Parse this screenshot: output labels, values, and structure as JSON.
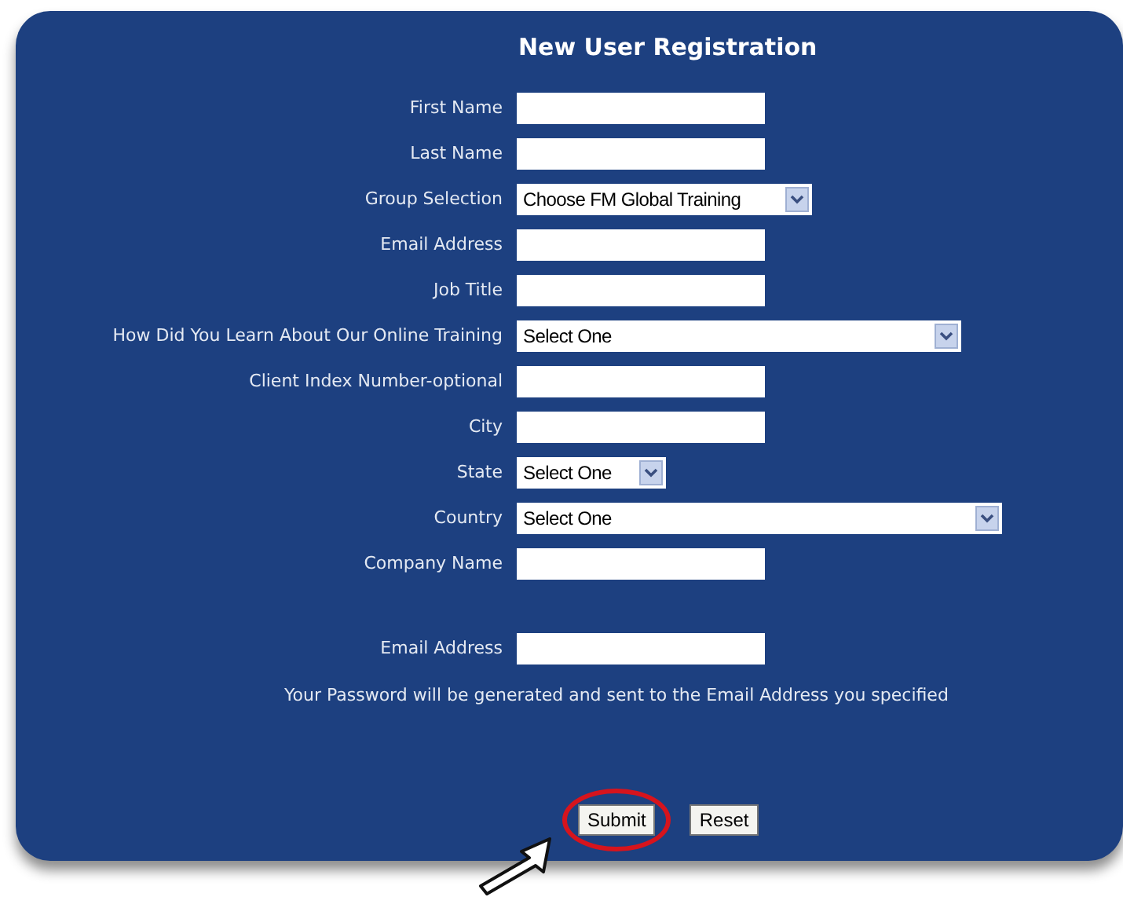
{
  "title": "New User Registration",
  "fields": [
    {
      "label": "First Name",
      "kind": "text"
    },
    {
      "label": "Last Name",
      "kind": "text"
    },
    {
      "label": "Group Selection",
      "kind": "select",
      "value": "Choose FM Global Training"
    },
    {
      "label": "Email Address",
      "kind": "text"
    },
    {
      "label": "Job Title",
      "kind": "text"
    },
    {
      "label": "How Did You Learn About Our Online Training",
      "kind": "select",
      "value": "Select One"
    },
    {
      "label": "Client Index Number-optional",
      "kind": "text"
    },
    {
      "label": "City",
      "kind": "text"
    },
    {
      "label": "State",
      "kind": "select",
      "value": "Select One"
    },
    {
      "label": "Country",
      "kind": "select",
      "value": "Select One"
    },
    {
      "label": "Company Name",
      "kind": "text"
    }
  ],
  "account": {
    "fields": [
      {
        "label": "Email Address",
        "kind": "text"
      }
    ],
    "note": "Your Password will be generated and sent to the Email Address you specified"
  },
  "buttons": [
    {
      "label": "Submit",
      "highlighted": true
    },
    {
      "label": "Reset",
      "highlighted": false
    }
  ]
}
